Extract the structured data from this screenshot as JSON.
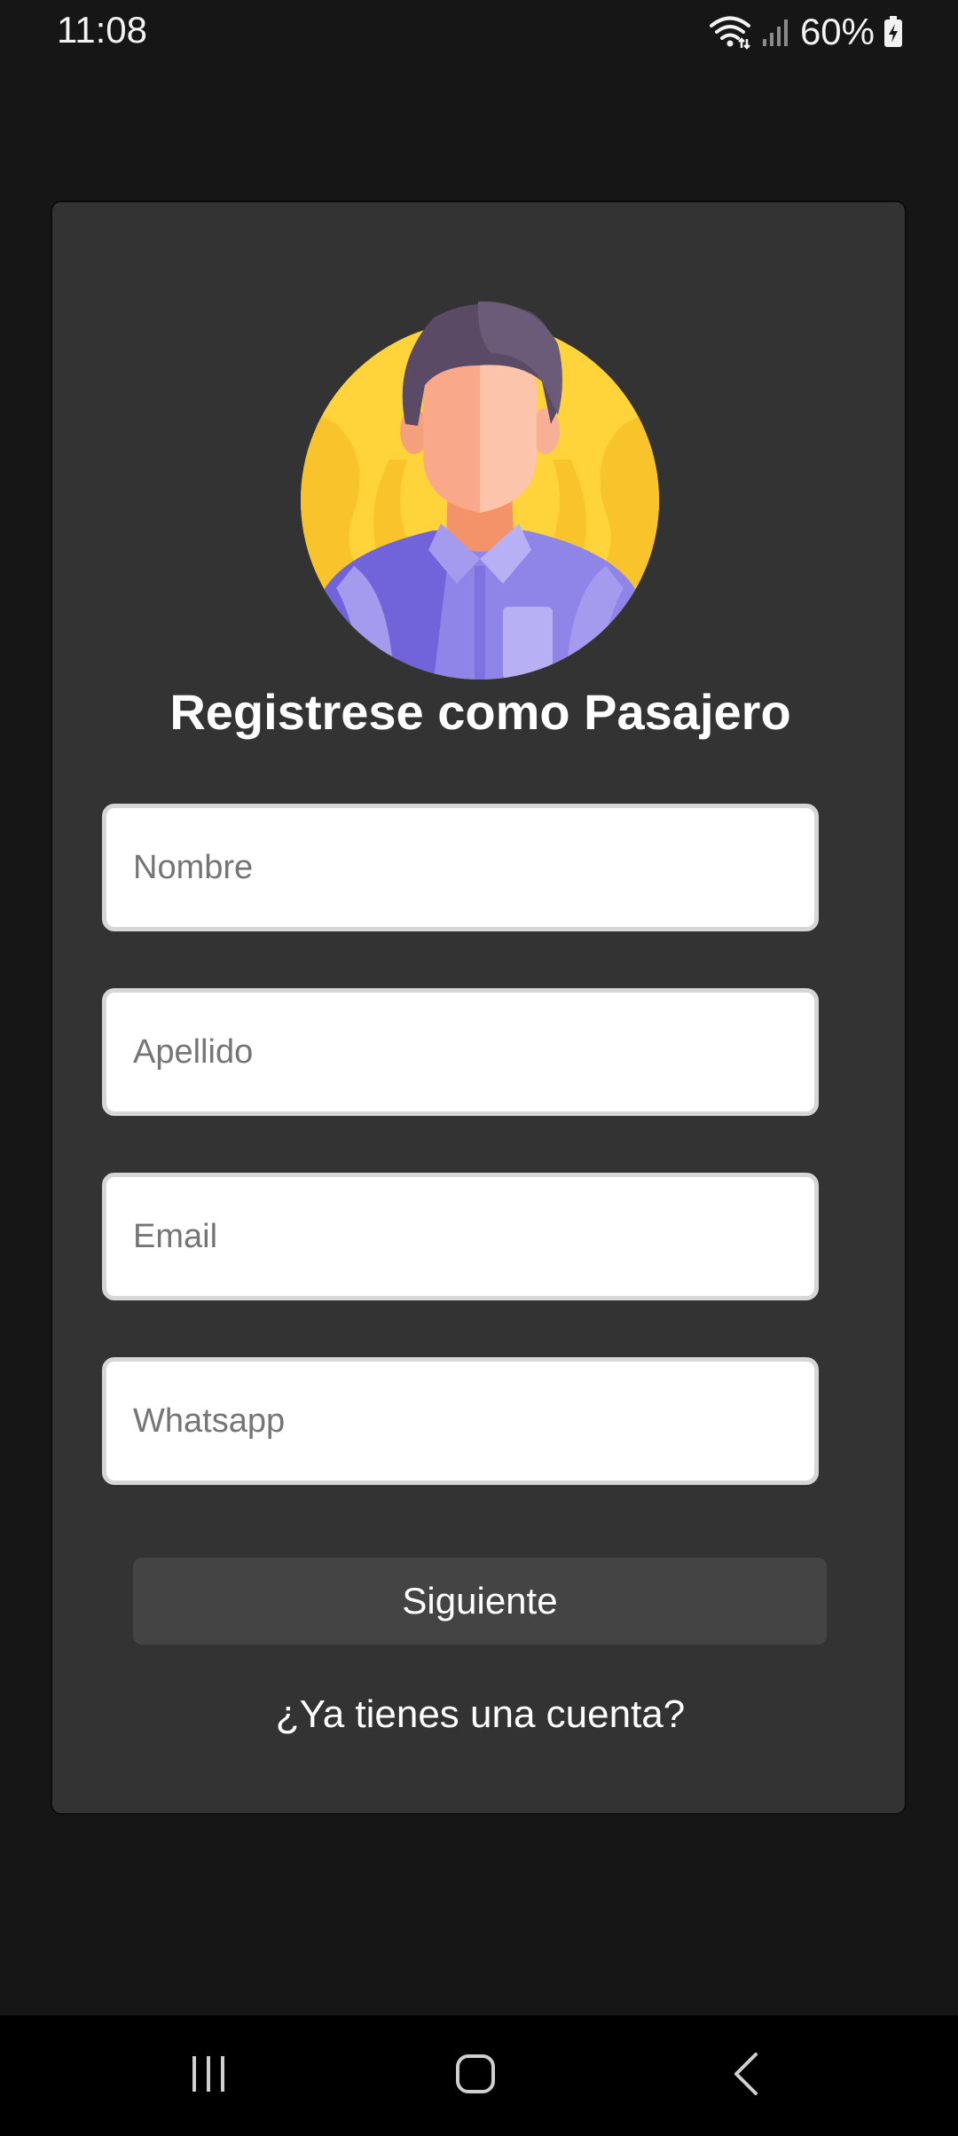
{
  "status_bar": {
    "time": "11:08",
    "battery": "60%",
    "icons": [
      "wifi-icon",
      "signal-icon",
      "battery-charging-icon"
    ]
  },
  "form": {
    "avatar_icon": "passenger-avatar",
    "title": "Registrese como Pasajero",
    "fields": [
      {
        "name": "nombre",
        "placeholder": "Nombre",
        "value": ""
      },
      {
        "name": "apellido",
        "placeholder": "Apellido",
        "value": ""
      },
      {
        "name": "email",
        "placeholder": "Email",
        "value": ""
      },
      {
        "name": "whatsapp",
        "placeholder": "Whatsapp",
        "value": ""
      }
    ],
    "next_button": "Siguiente",
    "login_link": "¿Ya tienes una cuenta?"
  },
  "nav_bar": {
    "icons": [
      "recent-apps-icon",
      "home-icon",
      "back-icon"
    ]
  },
  "colors": {
    "background": "#161616",
    "card": "#333333",
    "button": "#444444",
    "avatar_bg": "#FFD43B",
    "shirt": "#8F84E8"
  }
}
